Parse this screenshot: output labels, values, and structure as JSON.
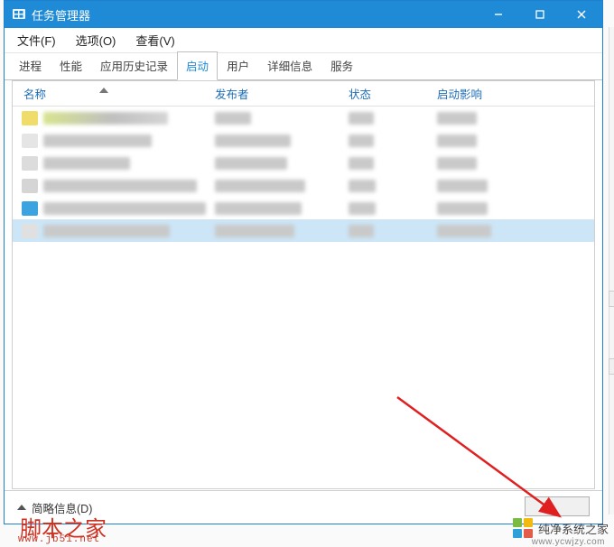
{
  "window": {
    "title": "任务管理器",
    "controls": {
      "min": "—",
      "max": "☐",
      "close": "✕"
    }
  },
  "menu": {
    "file": "文件(F)",
    "options": "选项(O)",
    "view": "查看(V)"
  },
  "tabs": [
    {
      "label": "进程"
    },
    {
      "label": "性能"
    },
    {
      "label": "应用历史记录"
    },
    {
      "label": "启动",
      "active": true
    },
    {
      "label": "用户"
    },
    {
      "label": "详细信息"
    },
    {
      "label": "服务"
    }
  ],
  "columns": {
    "name": "名称",
    "publisher": "发布者",
    "status": "状态",
    "impact": "启动影响"
  },
  "rows": [
    {
      "icon": "#f0dc6a",
      "name_w": 138,
      "pub_w": 40,
      "stat_w": 28,
      "imp_w": 44,
      "grad": true
    },
    {
      "icon": "#e5e5e5",
      "name_w": 120,
      "pub_w": 84,
      "stat_w": 28,
      "imp_w": 44
    },
    {
      "icon": "#dcdcdc",
      "name_w": 96,
      "pub_w": 80,
      "stat_w": 28,
      "imp_w": 44
    },
    {
      "icon": "#d5d5d5",
      "name_w": 170,
      "pub_w": 100,
      "stat_w": 30,
      "imp_w": 56
    },
    {
      "icon": "#3aa3e0",
      "name_w": 180,
      "pub_w": 96,
      "stat_w": 30,
      "imp_w": 56
    },
    {
      "icon": "#e0e0e0",
      "name_w": 140,
      "pub_w": 88,
      "stat_w": 28,
      "imp_w": 60,
      "selected": true
    }
  ],
  "footer": {
    "less_details": "简略信息(D)"
  },
  "watermarks": {
    "left_text": "脚本之家",
    "left_url": "www.jb51.net",
    "right_text": "纯净系统之家",
    "right_url": "www.ycwjzy.com",
    "logo_colors": [
      "#7bbb44",
      "#f2b90f",
      "#2f9fd8",
      "#e25c4a"
    ]
  }
}
